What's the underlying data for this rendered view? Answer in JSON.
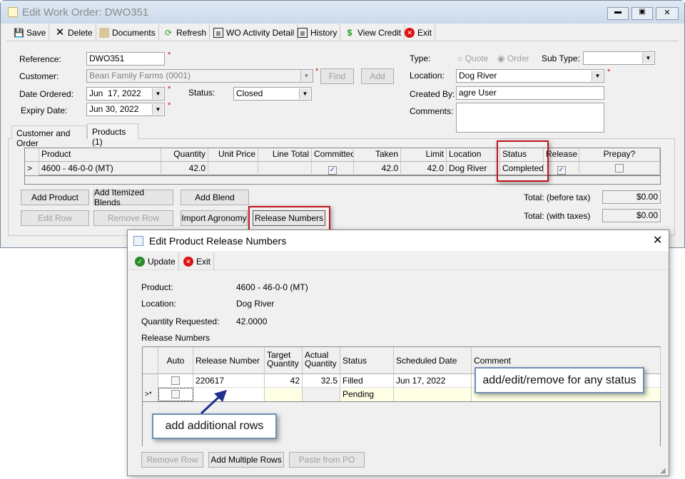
{
  "main_window": {
    "title": "Edit Work Order: DWO351",
    "toolbar": [
      {
        "label": "Save",
        "icon": "save-icon"
      },
      {
        "label": "Delete",
        "icon": "delete-icon"
      },
      {
        "label": "Documents",
        "icon": "documents-icon"
      },
      {
        "label": "Refresh",
        "icon": "refresh-icon"
      },
      {
        "label": "WO Activity Detail",
        "icon": "report-icon"
      },
      {
        "label": "History",
        "icon": "report-icon"
      },
      {
        "label": "View Credit",
        "icon": "dollar-icon"
      },
      {
        "label": "Exit",
        "icon": "exit-icon"
      }
    ],
    "form": {
      "reference_label": "Reference:",
      "reference": "DWO351",
      "customer_label": "Customer:",
      "customer": "Bean Family Farms (0001)",
      "find": "Find",
      "add": "Add",
      "date_ordered_label": "Date Ordered:",
      "date_ordered": "Jun  17, 2022",
      "status_label": "Status:",
      "status": "Closed",
      "expiry_label": "Expiry Date:",
      "expiry": "Jun 30, 2022",
      "type_label": "Type:",
      "type_quote": "Quote",
      "type_order": "Order",
      "subtype_label": "Sub Type:",
      "subtype": "",
      "location_label": "Location:",
      "location": "Dog River",
      "created_by_label": "Created By:",
      "created_by": "agre User",
      "comments_label": "Comments:",
      "comments": ""
    },
    "tabs": [
      "Customer and Order",
      "Products (1)"
    ],
    "products_grid": {
      "columns": [
        "Product",
        "Quantity",
        "Unit Price",
        "Line Total",
        "Committed",
        "Taken",
        "Limit",
        "Location",
        "Status",
        "Release",
        "Prepay?"
      ],
      "rows": [
        {
          "indicator": ">",
          "product": "4600 - 46-0-0 (MT)",
          "quantity": "42.0",
          "unit_price": "",
          "line_total": "",
          "committed": true,
          "taken": "42.0",
          "limit": "42.0",
          "location": "Dog River",
          "status": "Completed",
          "release": true,
          "prepay": false
        }
      ]
    },
    "buttons": {
      "add_product": "Add Product",
      "add_itemized": "Add Itemized Blends",
      "add_blend": "Add Blend",
      "edit_row": "Edit Row",
      "remove_row": "Remove Row",
      "import_agronomy": "Import Agronomy",
      "release_numbers": "Release Numbers"
    },
    "totals": {
      "before_tax_label": "Total: (before tax)",
      "before_tax": "$0.00",
      "with_taxes_label": "Total: (with taxes)",
      "with_taxes": "$0.00"
    }
  },
  "dialog": {
    "title": "Edit Product Release Numbers",
    "toolbar": {
      "update": "Update",
      "exit": "Exit"
    },
    "product_label": "Product:",
    "product": "4600 - 46-0-0 (MT)",
    "location_label": "Location:",
    "location": "Dog River",
    "qty_label": "Quantity Requested:",
    "qty": "42.0000",
    "release_numbers_label": "Release Numbers",
    "grid": {
      "columns": [
        "Auto",
        "Release Number",
        "Target Quantity",
        "Actual Quantity",
        "Status",
        "Scheduled Date",
        "Comment"
      ],
      "rows": [
        {
          "indicator": "",
          "auto": false,
          "release_number": "220617",
          "target": "42",
          "actual": "32.5",
          "status": "Filled",
          "scheduled": "Jun 17, 2022",
          "comment": ""
        },
        {
          "indicator": ">*",
          "auto": false,
          "release_number": "",
          "target": "",
          "actual": "",
          "status": "Pending",
          "scheduled": "",
          "comment": ""
        }
      ]
    },
    "buttons": {
      "remove_row": "Remove Row",
      "add_multiple": "Add Multiple Rows",
      "paste_po": "Paste from PO"
    }
  },
  "annotations": {
    "callout_status": "add/edit/remove for any status",
    "callout_rows": "add additional rows",
    "highlight_color": "#c0161c",
    "arrow_color": "#1f2f8c"
  }
}
